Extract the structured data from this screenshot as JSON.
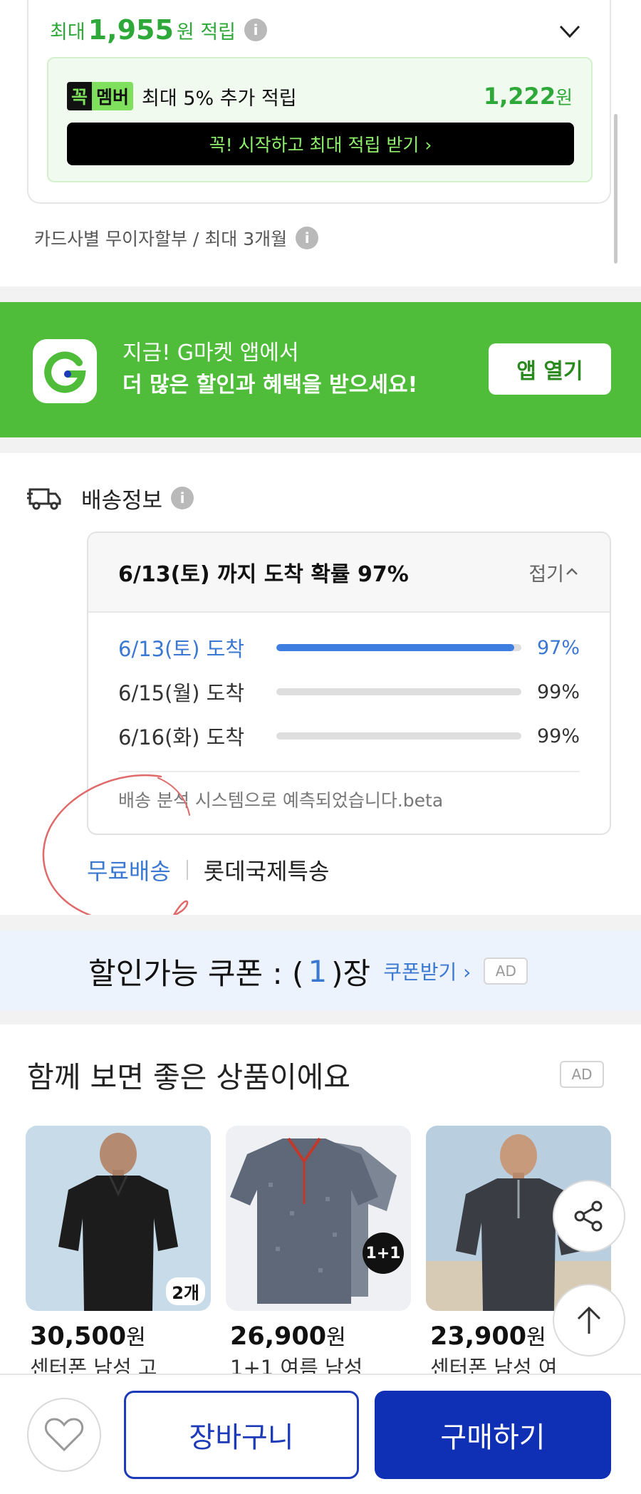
{
  "reward": {
    "prefix": "최대",
    "amount": "1,955",
    "suffix": "원 적립",
    "info_glyph": "i",
    "member": {
      "logo_part1": "꼭",
      "logo_part2": "멤버",
      "text": "최대 5% 추가 적립",
      "amount": "1,222",
      "won": "원"
    },
    "cta": "꼭! 시작하고 최대 적립 받기 ›"
  },
  "installment": {
    "text": "카드사별 무이자할부 / 최대 3개월"
  },
  "app_banner": {
    "line1": "지금! G마켓 앱에서",
    "line2": "더 많은 할인과 혜택을 받으세요!",
    "button": "앱 열기",
    "brand_color": "#4fbd3a"
  },
  "shipping": {
    "title": "배송정보",
    "headline": "6/13(토) 까지 도착 확률 97%",
    "fold_label": "접기",
    "rows": [
      {
        "date": "6/13(토) 도착",
        "percent": "97%",
        "fill": 0.97
      },
      {
        "date": "6/15(월) 도착",
        "percent": "99%",
        "fill": 0
      },
      {
        "date": "6/16(화) 도착",
        "percent": "99%",
        "fill": 0
      }
    ],
    "note": "배송 분석 시스템으로 예측되었습니다.beta",
    "free_shipping": "무료배송",
    "carrier": "롯데국제특송"
  },
  "coupon": {
    "label_prefix": "할인가능 쿠폰 : (",
    "count": "1",
    "label_suffix": ")장",
    "get_label": "쿠폰받기 ›",
    "ad": "AD"
  },
  "recommend": {
    "title": "함께 보면 좋은 상품이에요",
    "ad": "AD",
    "products": [
      {
        "price": "30,500",
        "won": "원",
        "name": "센터폰 남성 고",
        "badge": "2개"
      },
      {
        "price": "26,900",
        "won": "원",
        "name": "1+1 여름 남성",
        "badge": "1+1"
      },
      {
        "price": "23,900",
        "won": "원",
        "name": "센터폰 남성 여",
        "badge": ""
      }
    ]
  },
  "bottom_bar": {
    "cart": "장바구니",
    "buy": "구매하기",
    "accent": "#0f2fb5"
  }
}
